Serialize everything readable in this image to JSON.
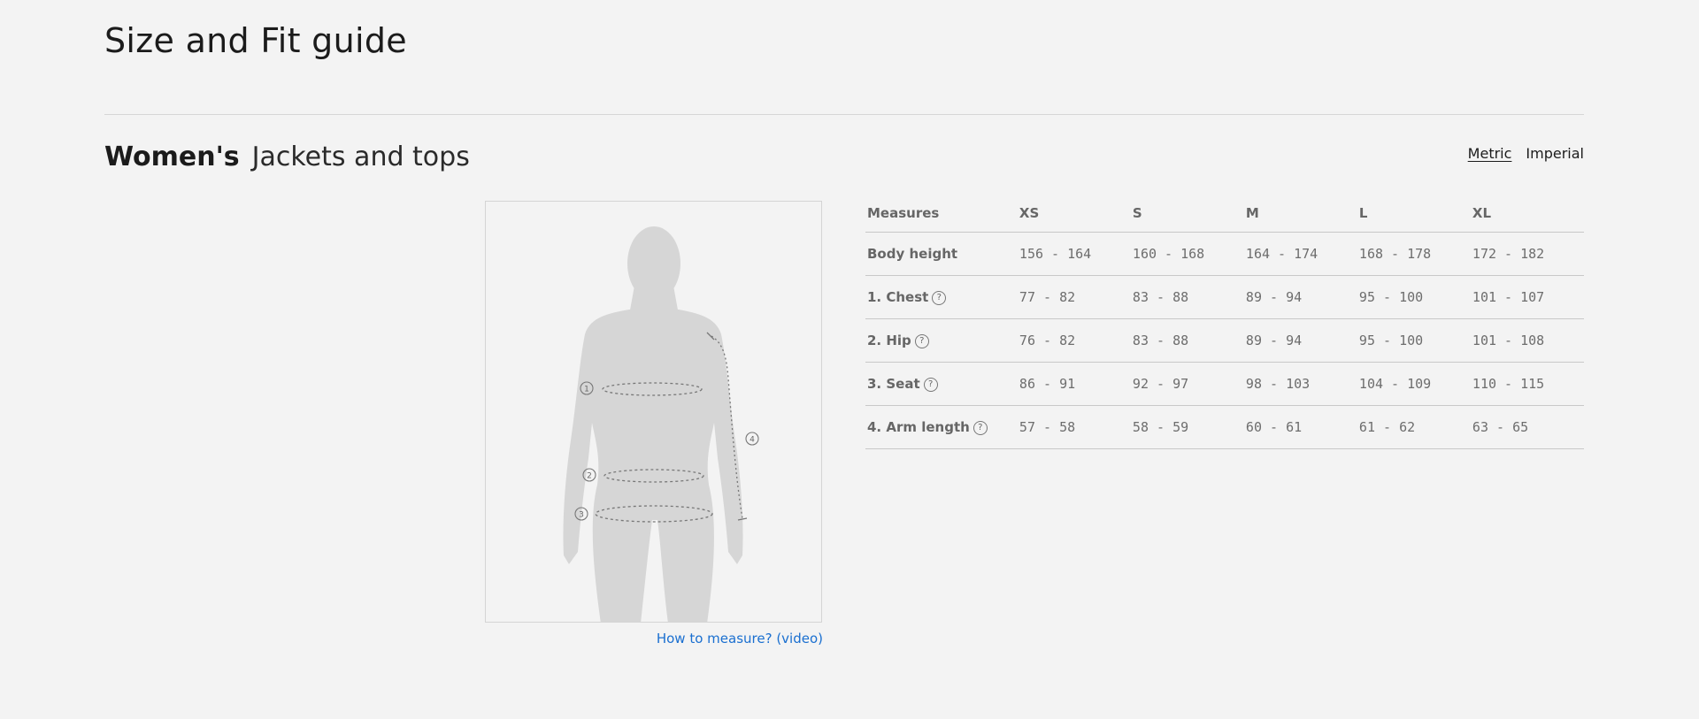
{
  "page": {
    "title": "Size and Fit guide"
  },
  "section": {
    "gender": "Women's",
    "category": "Jackets and tops"
  },
  "units": {
    "options": [
      "Metric",
      "Imperial"
    ],
    "selected": "Metric"
  },
  "figure": {
    "markers": [
      "1",
      "2",
      "3",
      "4"
    ],
    "link_text": "How to measure? (video)"
  },
  "table": {
    "header_label": "Measures",
    "sizes": [
      "XS",
      "S",
      "M",
      "L",
      "XL"
    ],
    "rows": [
      {
        "label": "Body height",
        "help": false,
        "values": [
          "156 - 164",
          "160 - 168",
          "164 - 174",
          "168 - 178",
          "172 - 182"
        ]
      },
      {
        "label": "1. Chest",
        "help": true,
        "values": [
          "77 - 82",
          "83 - 88",
          "89 - 94",
          "95 - 100",
          "101 - 107"
        ]
      },
      {
        "label": "2. Hip",
        "help": true,
        "values": [
          "76 - 82",
          "83 - 88",
          "89 - 94",
          "95 - 100",
          "101 - 108"
        ]
      },
      {
        "label": "3. Seat",
        "help": true,
        "values": [
          "86 - 91",
          "92 - 97",
          "98 - 103",
          "104 - 109",
          "110 - 115"
        ]
      },
      {
        "label": "4. Arm length",
        "help": true,
        "values": [
          "57 - 58",
          "58 - 59",
          "60 - 61",
          "61 - 62",
          "63 - 65"
        ]
      }
    ],
    "help_glyph": "?"
  },
  "colors": {
    "background": "#f3f3f3",
    "link": "#1a6fd0",
    "silhouette": "#d6d6d6"
  }
}
